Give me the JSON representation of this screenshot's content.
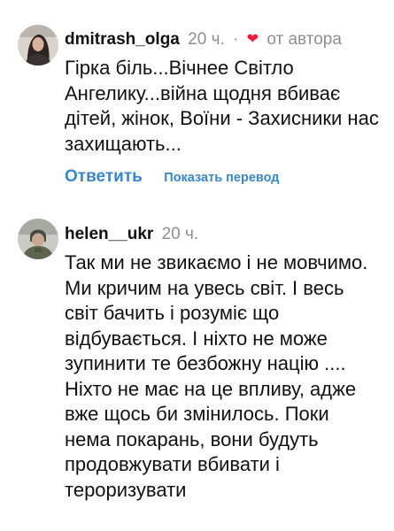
{
  "comments": [
    {
      "username": "dmitrash_olga",
      "time": "20 ч.",
      "separator": "·",
      "heart_icon": "heart-icon",
      "author_badge": "от автора",
      "text": "Гірка біль...Вічнее Світло Ангелику...війна щодня вбиває дітей, жінок, Воїни - Захисники нас захищають...",
      "reply_label": "Ответить",
      "translate_label": "Показать перевод"
    },
    {
      "username": "helen__ukr",
      "time": "20 ч.",
      "text": "Так ми не звикаємо і не мовчимо. Ми кричим на увесь світ. І весь світ бачить і розуміє що відбувається. І ніхто не може зупинити те безбожну націю .... Ніхто не має на це впливу, адже вже щось би змінилось. Поки нема покарань, вони будуть продовжувати вбивати і тероризувати"
    }
  ],
  "colors": {
    "link": "#3a86c8",
    "muted": "#8e8e8e",
    "heart": "#ed1b3a",
    "text": "#111111"
  }
}
